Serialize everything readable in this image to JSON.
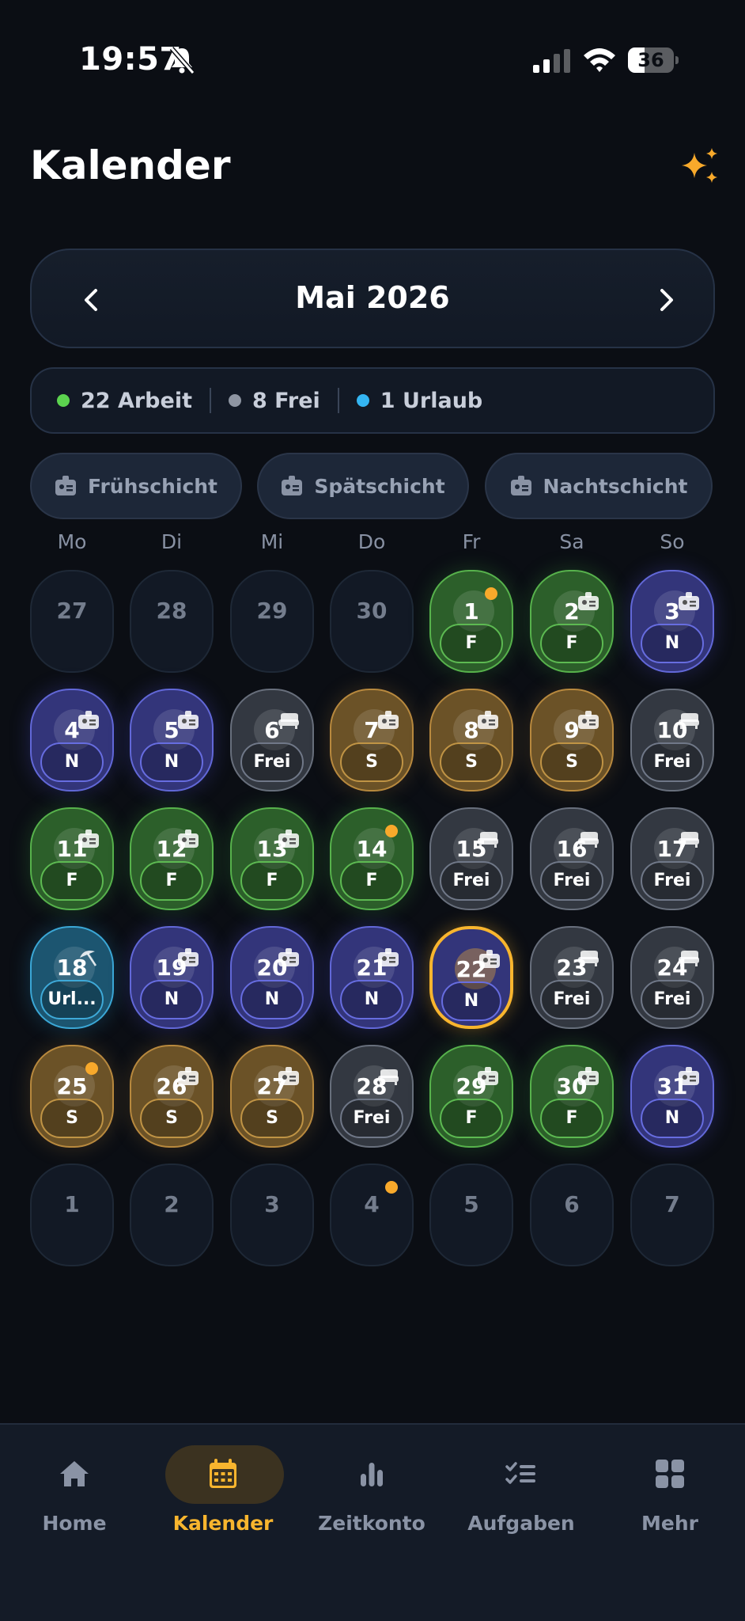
{
  "status_bar": {
    "time": "19:57",
    "battery": "36",
    "battery_level": 0.36
  },
  "header": {
    "title": "Kalender"
  },
  "month_nav": {
    "label": "Mai 2026"
  },
  "summary": {
    "items": [
      {
        "label": "22 Arbeit",
        "color": "#5cd34f"
      },
      {
        "label": "8 Frei",
        "color": "#8e95a2"
      },
      {
        "label": "1 Urlaub",
        "color": "#34b5f2"
      }
    ]
  },
  "shift_buttons": [
    "Frühschicht",
    "Spätschicht",
    "Nachtschicht"
  ],
  "weekdays": [
    "Mo",
    "Di",
    "Mi",
    "Do",
    "Fr",
    "Sa",
    "So"
  ],
  "shift_labels": {
    "F": "F",
    "S": "S",
    "N": "N",
    "Frei": "Frei",
    "U": "Url..."
  },
  "calendar": {
    "leading_days": [
      "27",
      "28",
      "29",
      "30"
    ],
    "days": [
      {
        "day": "1",
        "shift": "F",
        "dot": true,
        "icon": "none"
      },
      {
        "day": "2",
        "shift": "F",
        "icon": "badge"
      },
      {
        "day": "3",
        "shift": "N",
        "icon": "badge"
      },
      {
        "day": "4",
        "shift": "N",
        "icon": "badge"
      },
      {
        "day": "5",
        "shift": "N",
        "icon": "badge"
      },
      {
        "day": "6",
        "shift": "Frei",
        "icon": "sofa"
      },
      {
        "day": "7",
        "shift": "S",
        "icon": "badge"
      },
      {
        "day": "8",
        "shift": "S",
        "icon": "badge"
      },
      {
        "day": "9",
        "shift": "S",
        "icon": "badge"
      },
      {
        "day": "10",
        "shift": "Frei",
        "icon": "sofa"
      },
      {
        "day": "11",
        "shift": "F",
        "icon": "badge"
      },
      {
        "day": "12",
        "shift": "F",
        "icon": "badge"
      },
      {
        "day": "13",
        "shift": "F",
        "icon": "badge"
      },
      {
        "day": "14",
        "shift": "F",
        "dot": true,
        "icon": "none"
      },
      {
        "day": "15",
        "shift": "Frei",
        "icon": "sofa"
      },
      {
        "day": "16",
        "shift": "Frei",
        "icon": "sofa"
      },
      {
        "day": "17",
        "shift": "Frei",
        "icon": "sofa"
      },
      {
        "day": "18",
        "shift": "U",
        "icon": "umbrella"
      },
      {
        "day": "19",
        "shift": "N",
        "icon": "badge"
      },
      {
        "day": "20",
        "shift": "N",
        "icon": "badge"
      },
      {
        "day": "21",
        "shift": "N",
        "icon": "badge"
      },
      {
        "day": "22",
        "shift": "N",
        "icon": "badge",
        "today": true
      },
      {
        "day": "23",
        "shift": "Frei",
        "icon": "sofa"
      },
      {
        "day": "24",
        "shift": "Frei",
        "icon": "sofa"
      },
      {
        "day": "25",
        "shift": "S",
        "dot": true,
        "icon": "none"
      },
      {
        "day": "26",
        "shift": "S",
        "icon": "badge"
      },
      {
        "day": "27",
        "shift": "S",
        "icon": "badge"
      },
      {
        "day": "28",
        "shift": "Frei",
        "icon": "sofa"
      },
      {
        "day": "29",
        "shift": "F",
        "icon": "badge"
      },
      {
        "day": "30",
        "shift": "F",
        "icon": "badge"
      },
      {
        "day": "31",
        "shift": "N",
        "icon": "badge"
      }
    ],
    "trailing_days": [
      {
        "day": "1"
      },
      {
        "day": "2"
      },
      {
        "day": "3"
      },
      {
        "day": "4",
        "dot": true
      },
      {
        "day": "5"
      },
      {
        "day": "6"
      },
      {
        "day": "7"
      }
    ]
  },
  "tabbar": {
    "tabs": [
      {
        "label": "Home",
        "icon": "home-icon"
      },
      {
        "label": "Kalender",
        "icon": "calendar-icon",
        "active": true
      },
      {
        "label": "Zeitkonto",
        "icon": "bar-chart-icon"
      },
      {
        "label": "Aufgaben",
        "icon": "checklist-icon"
      },
      {
        "label": "Mehr",
        "icon": "grid-icon"
      }
    ]
  },
  "colors": {
    "accent": "#f8b52e",
    "background": "#0b0e14"
  }
}
